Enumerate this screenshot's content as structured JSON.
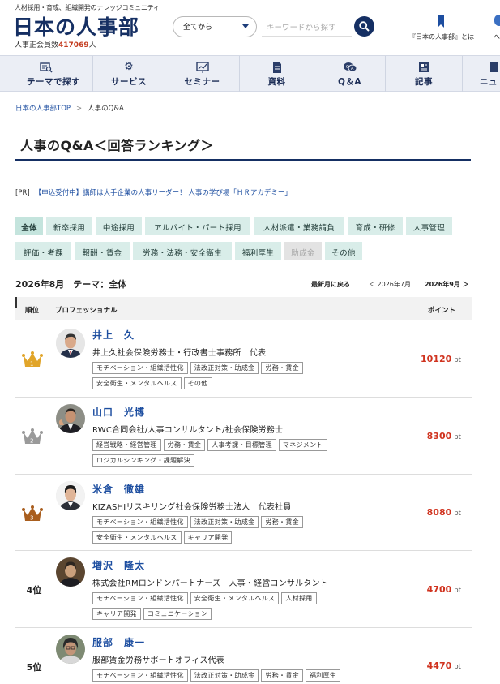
{
  "header": {
    "tagline": "人材採用・育成、組織開発のナレッジコミュニティ",
    "logo": "日本の人事部",
    "members_label": "人事正会員数",
    "members_count": "417069",
    "members_unit": "人",
    "search_scope": "全てから",
    "search_placeholder": "キーワードから探す",
    "about_label": "『日本の人事部』とは",
    "help_label": "ヘ"
  },
  "nav": [
    {
      "label": "テーマで探す",
      "icon": "search-list-icon"
    },
    {
      "label": "サービス",
      "icon": "gears-icon"
    },
    {
      "label": "セミナー",
      "icon": "presentation-icon"
    },
    {
      "label": "資料",
      "icon": "document-icon"
    },
    {
      "label": "Q＆A",
      "icon": "chat-bubbles-icon"
    },
    {
      "label": "記事",
      "icon": "newspaper-icon"
    },
    {
      "label": "ニュ",
      "icon": "news-icon"
    }
  ],
  "breadcrumb": {
    "home": "日本の人事部TOP",
    "current": "人事のQ&A"
  },
  "page_title": "人事のQ&A＜回答ランキング＞",
  "pr": {
    "tag": "[PR]",
    "text": "【申込受付中】講師は大手企業の人事リーダー！ 人事の学び場「ＨＲアカデミー」"
  },
  "themes": [
    {
      "label": "全体",
      "state": "active"
    },
    {
      "label": "新卒採用",
      "state": "normal"
    },
    {
      "label": "中途採用",
      "state": "normal"
    },
    {
      "label": "アルバイト・パート採用",
      "state": "normal"
    },
    {
      "label": "人材派遣・業務請負",
      "state": "normal"
    },
    {
      "label": "育成・研修",
      "state": "normal"
    },
    {
      "label": "人事管理",
      "state": "normal"
    },
    {
      "label": "評価・考課",
      "state": "normal"
    },
    {
      "label": "報酬・賃金",
      "state": "normal"
    },
    {
      "label": "労務・法務・安全衛生",
      "state": "normal"
    },
    {
      "label": "福利厚生",
      "state": "normal"
    },
    {
      "label": "助成金",
      "state": "disabled"
    },
    {
      "label": "その他",
      "state": "normal"
    }
  ],
  "month": {
    "title": "2026年8月　テーマ：全体",
    "latest": "最新月に戻る",
    "prev": "＜ 2026年7月",
    "next": "2026年9月 ＞"
  },
  "table_headers": {
    "rank": "順位",
    "pro": "プロフェッショナル",
    "points": "ポイント"
  },
  "points_unit": "pt",
  "colors": {
    "brand": "#152f63",
    "link": "#1d4ea0",
    "points": "#d0331f",
    "chip": "#d9ede9",
    "gold": "#e1a52a",
    "silver": "#9a9a9a",
    "bronze": "#a95e1e"
  },
  "rankings": [
    {
      "rank": "1",
      "rank_label": "",
      "crown": "gold-crown-icon",
      "name": "井上　久",
      "org": "井上久社会保険労務士・行政書士事務所　代表",
      "points": "10120",
      "tags": [
        "モチベーション・組織活性化",
        "法改正対策・助成金",
        "労務・賃金",
        "安全衛生・メンタルヘルス",
        "その他"
      ]
    },
    {
      "rank": "2",
      "rank_label": "",
      "crown": "silver-crown-icon",
      "name": "山口　光博",
      "org": "RWC合同会社/人事コンサルタント/社会保険労務士",
      "points": "8300",
      "tags": [
        "経営戦略・経営管理",
        "労務・賃金",
        "人事考課・目標管理",
        "マネジメント",
        "ロジカルシンキング・課題解決"
      ]
    },
    {
      "rank": "3",
      "rank_label": "",
      "crown": "bronze-crown-icon",
      "name": "米倉　徹雄",
      "org": "KIZASHIリスキリング社会保険労務士法人　代表社員",
      "points": "8080",
      "tags": [
        "モチベーション・組織活性化",
        "法改正対策・助成金",
        "労務・賃金",
        "安全衛生・メンタルヘルス",
        "キャリア開発"
      ]
    },
    {
      "rank": "4",
      "rank_label": "4位",
      "crown": "",
      "name": "増沢　隆太",
      "org": "株式会社RMロンドンパートナーズ　人事・経営コンサルタント",
      "points": "4700",
      "tags": [
        "モチベーション・組織活性化",
        "安全衛生・メンタルヘルス",
        "人材採用",
        "キャリア開発",
        "コミュニケーション"
      ]
    },
    {
      "rank": "5",
      "rank_label": "5位",
      "crown": "",
      "name": "服部　康一",
      "org": "服部賃金労務サポートオフィス代表",
      "points": "4470",
      "tags": [
        "モチベーション・組織活性化",
        "法改正対策・助成金",
        "労務・賃金",
        "福利厚生"
      ]
    }
  ]
}
